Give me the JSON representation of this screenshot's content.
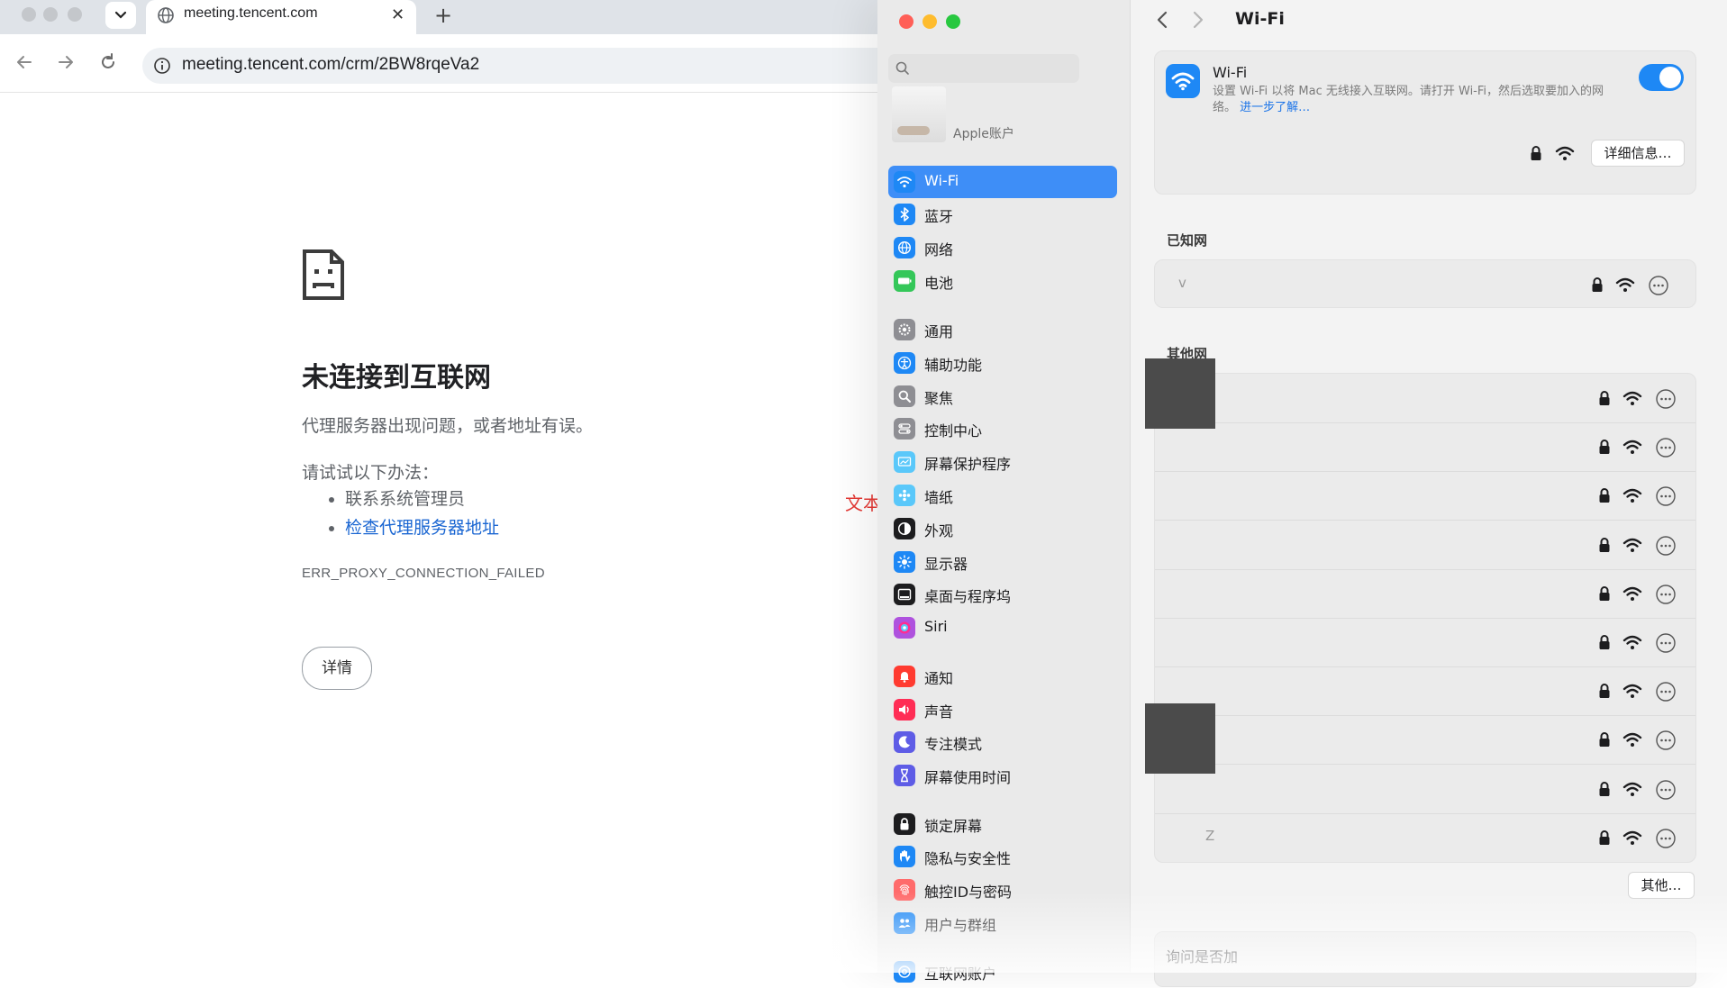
{
  "browser": {
    "tab_title": "meeting.tencent.com",
    "url": "meeting.tencent.com/crm/2BW8rqeVa2",
    "error": {
      "title": "未连接到互联网",
      "description": "代理服务器出现问题，或者地址有误。",
      "try_label": "请试试以下办法：",
      "suggestions": [
        "联系系统管理员",
        "检查代理服务器地址"
      ],
      "code": "ERR_PROXY_CONNECTION_FAILED",
      "details_button": "详情"
    }
  },
  "annotation": "文本",
  "settings": {
    "account_label": "Apple账户",
    "sidebar": [
      {
        "label": "Wi-Fi",
        "icon": "wifi-icon",
        "color": "#1e88f5",
        "selected": true
      },
      {
        "label": "蓝牙",
        "icon": "bluetooth-icon",
        "color": "#1e88f5"
      },
      {
        "label": "网络",
        "icon": "globe-icon",
        "color": "#1e88f5"
      },
      {
        "label": "电池",
        "icon": "battery-icon",
        "color": "#34c759"
      },
      {
        "label": "通用",
        "icon": "gear-icon",
        "color": "#8e8e93"
      },
      {
        "label": "辅助功能",
        "icon": "accessibility-icon",
        "color": "#1e88f5"
      },
      {
        "label": "聚焦",
        "icon": "spotlight-icon",
        "color": "#8e8e93"
      },
      {
        "label": "控制中心",
        "icon": "control-center-icon",
        "color": "#8e8e93"
      },
      {
        "label": "屏幕保护程序",
        "icon": "screensaver-icon",
        "color": "#5ac8fa"
      },
      {
        "label": "墙纸",
        "icon": "wallpaper-icon",
        "color": "#5ac8fa"
      },
      {
        "label": "外观",
        "icon": "appearance-icon",
        "color": "#1d1d1f"
      },
      {
        "label": "显示器",
        "icon": "display-icon",
        "color": "#1e88f5"
      },
      {
        "label": "桌面与程序坞",
        "icon": "dock-icon",
        "color": "#1d1d1f"
      },
      {
        "label": "Siri",
        "icon": "siri-icon",
        "color": "#af52de"
      },
      {
        "label": "通知",
        "icon": "notification-icon",
        "color": "#ff3b30"
      },
      {
        "label": "声音",
        "icon": "sound-icon",
        "color": "#ff2d55"
      },
      {
        "label": "专注模式",
        "icon": "focus-icon",
        "color": "#5e5ce6"
      },
      {
        "label": "屏幕使用时间",
        "icon": "screen-time-icon",
        "color": "#5e5ce6"
      },
      {
        "label": "锁定屏幕",
        "icon": "lock-screen-icon",
        "color": "#1d1d1f"
      },
      {
        "label": "隐私与安全性",
        "icon": "privacy-hand-icon",
        "color": "#1e88f5"
      },
      {
        "label": "触控ID与密码",
        "icon": "fingerprint-icon",
        "color": "#ff6b6b"
      },
      {
        "label": "用户与群组",
        "icon": "users-icon",
        "color": "#1e88f5"
      },
      {
        "label": "互联网账户",
        "icon": "internet-accounts-icon",
        "color": "#1e88f5"
      }
    ],
    "wifi": {
      "pane_title": "Wi-Fi",
      "card_title": "Wi-Fi",
      "card_desc": "设置 Wi-Fi 以将 Mac 无线接入互联网。请打开 Wi-Fi，然后选取要加入的网络。",
      "learn_more": "进一步了解…",
      "enabled": true,
      "details_button": "详细信息…",
      "known_header": "已知网",
      "known_network": "v",
      "other_header": "其他网",
      "other_networks": [
        "",
        "",
        "",
        "",
        "",
        "",
        "",
        "",
        "",
        "Z"
      ],
      "other_button": "其他…",
      "ask_join": "询问是否加"
    }
  }
}
